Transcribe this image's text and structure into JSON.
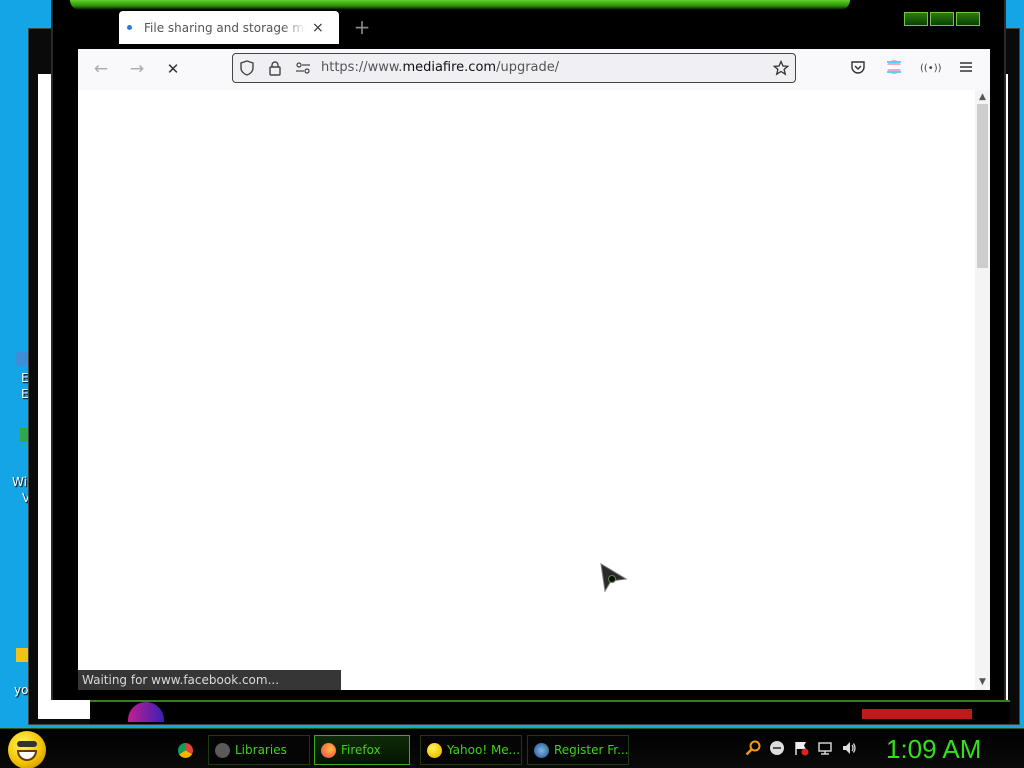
{
  "desktop": {
    "fragments": [
      "E",
      "E",
      "Wi",
      "V",
      "yo"
    ]
  },
  "browser": {
    "tab": {
      "title": "File sharing and storage made simple",
      "close_icon": "×"
    },
    "new_tab_icon": "+",
    "nav": {
      "back_icon": "←",
      "forward_icon": "→",
      "stop_icon": "✕"
    },
    "url": {
      "prefix": "https://www.",
      "domain": "mediafire.com",
      "path": "/upgrade/"
    },
    "status_text": "Waiting for www.facebook.com...",
    "colors": {
      "chrome_bg": "#000000",
      "navbar_bg": "#f9f9fb",
      "status_bg": "#363636"
    }
  },
  "taskbar": {
    "tasks": [
      {
        "label": "",
        "icon": "chrome-icon"
      },
      {
        "label": "Libraries",
        "icon": "folder-icon"
      },
      {
        "label": "Firefox",
        "icon": "firefox-icon"
      },
      {
        "label": "Yahoo! Me...",
        "icon": "yahoo-messenger-icon"
      },
      {
        "label": "Register Fr...",
        "icon": "globe-icon"
      }
    ],
    "clock": "1:09 AM",
    "accent_color": "#33e01a"
  }
}
